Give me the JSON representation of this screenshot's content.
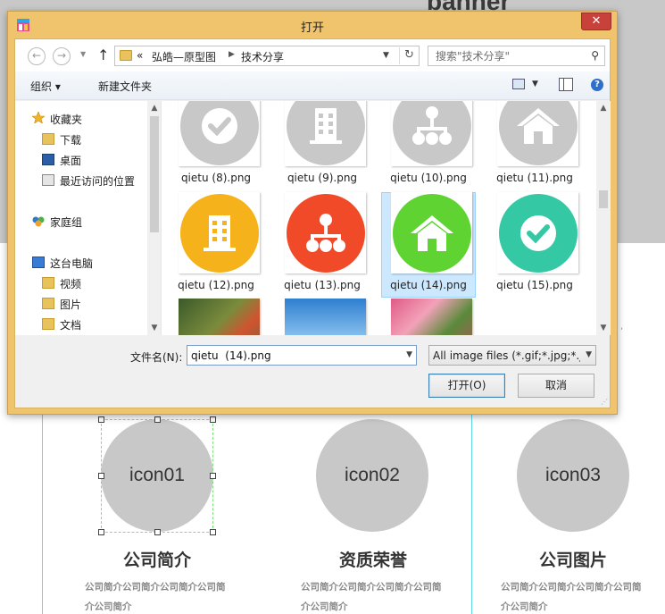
{
  "background": {
    "banner_title": "banner",
    "icons": [
      "icon01",
      "icon02",
      "icon03"
    ],
    "sections": [
      {
        "title": "公司简介",
        "desc_line1": "公司简介公司简介公司简介公司简",
        "desc_line2": "介公司简介"
      },
      {
        "title": "资质荣誉",
        "desc_line1": "公司简介公司简介公司简介公司简",
        "desc_line2": "介公司简介"
      },
      {
        "title": "公司图片",
        "desc_line1": "公司简介公司简介公司简介公司简",
        "desc_line2": "介公司简介"
      }
    ]
  },
  "dialog": {
    "title": "打开",
    "close_label": "✕",
    "address": {
      "prefix": "«",
      "segments": [
        "弘皓—原型图",
        "技术分享"
      ]
    },
    "search_placeholder": "搜索\"技术分享\"",
    "toolbar": {
      "organize": "组织 ▾",
      "new_folder": "新建文件夹"
    },
    "nav_items": [
      {
        "label": "收藏夹",
        "icon": "star-icon"
      },
      {
        "label": "下载",
        "icon": "download-folder-icon"
      },
      {
        "label": "桌面",
        "icon": "desktop-icon"
      },
      {
        "label": "最近访问的位置",
        "icon": "recent-places-icon"
      },
      {
        "label": "家庭组",
        "icon": "homegroup-icon"
      },
      {
        "label": "这台电脑",
        "icon": "computer-icon"
      },
      {
        "label": "视频",
        "icon": "video-folder-icon"
      },
      {
        "label": "图片",
        "icon": "pictures-folder-icon"
      },
      {
        "label": "文档",
        "icon": "documents-folder-icon"
      }
    ],
    "files": [
      {
        "name": "qietu  (8).png",
        "color": "#c8c8c8",
        "glyph": "check-icon"
      },
      {
        "name": "qietu  (9).png",
        "color": "#c8c8c8",
        "glyph": "building-icon"
      },
      {
        "name": "qietu  (10).png",
        "color": "#c8c8c8",
        "glyph": "org-chart-icon"
      },
      {
        "name": "qietu  (11).png",
        "color": "#c8c8c8",
        "glyph": "home-icon"
      },
      {
        "name": "qietu  (12).png",
        "color": "#f5b21a",
        "glyph": "building-icon"
      },
      {
        "name": "qietu  (13).png",
        "color": "#f14a28",
        "glyph": "org-chart-icon"
      },
      {
        "name": "qietu  (14).png",
        "color": "#5fd332",
        "glyph": "home-icon"
      },
      {
        "name": "qietu  (15).png",
        "color": "#34c8a4",
        "glyph": "check-icon"
      },
      {
        "name": "",
        "color": "#6b7b3a",
        "glyph": "flowers-photo"
      },
      {
        "name": "",
        "color": "#3f8fd6",
        "glyph": "sky-photo"
      },
      {
        "name": "",
        "color": "#c03b6a",
        "glyph": "tulips-photo"
      }
    ],
    "selected_file": "qietu  (14).png",
    "filename_label": "文件名(N):",
    "filename_value": "qietu  (14).png",
    "filter_value": "All image files (*.gif;*.jpg;*.jp",
    "open_button": "打开(O)",
    "cancel_button": "取消"
  }
}
